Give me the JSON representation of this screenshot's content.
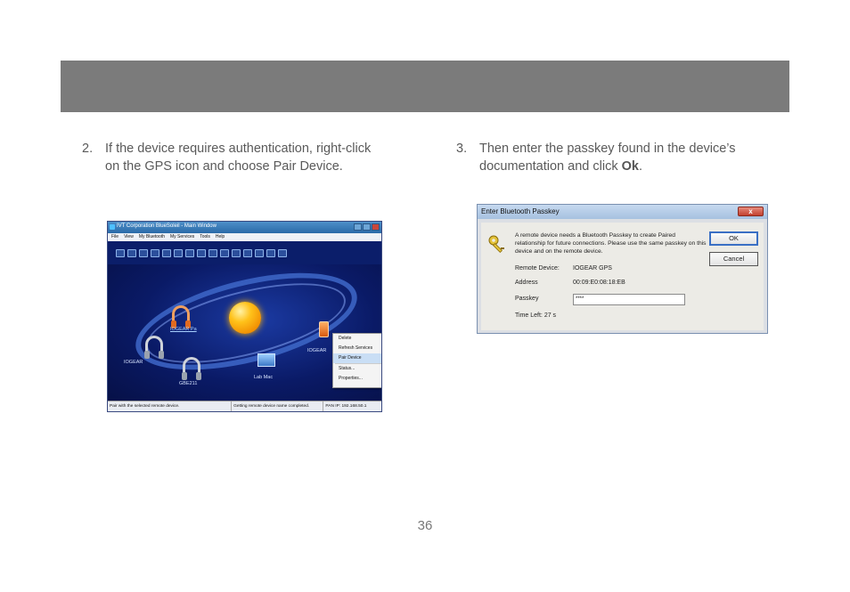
{
  "step2": {
    "number": "2.",
    "text": "If the device requires authentication, right-click on the GPS icon and choose Pair Device."
  },
  "step3": {
    "number": "3.",
    "text_before": "Then enter the passkey found in the device’s documentation and click ",
    "bold": "Ok",
    "text_after": "."
  },
  "page_number": "36",
  "bluesoleil": {
    "window_title": "IVT Corporation BlueSoleil - Main Window",
    "menu": [
      "File",
      "View",
      "My Bluetooth",
      "My Services",
      "Tools",
      "Help"
    ],
    "devices": [
      "IOGEAR Pa",
      "IOGEAR",
      "GBE211",
      "Lab Mac",
      "IOGEAR"
    ],
    "context_menu": [
      "Delete",
      "Refresh Services",
      "Pair Device",
      "Status...",
      "Properties..."
    ],
    "status": [
      "Pair with the selected remote device.",
      "Getting remote device name completed.",
      "PAN IP: 192.168.50.1"
    ]
  },
  "passkey_dialog": {
    "title": "Enter Bluetooth Passkey",
    "close": "x",
    "message": "A remote device needs a Bluetooth Passkey to create Paired relationship for future connections. Please use the same passkey on this device and on the remote device.",
    "ok_label": "OK",
    "cancel_label": "Cancel",
    "remote_device_label": "Remote Device:",
    "remote_device_value": "IOGEAR GPS",
    "address_label": "Address",
    "address_value": "00:09:E0:08:18:EB",
    "passkey_label": "Passkey",
    "passkey_value": "****",
    "time_left_label": "Time Left:",
    "time_left_value": "27 s"
  },
  "colors": {
    "banner": "#7b7b7b",
    "bluesoleil_bg": "#0a1a5e",
    "accent_orange": "#ffc21a"
  }
}
